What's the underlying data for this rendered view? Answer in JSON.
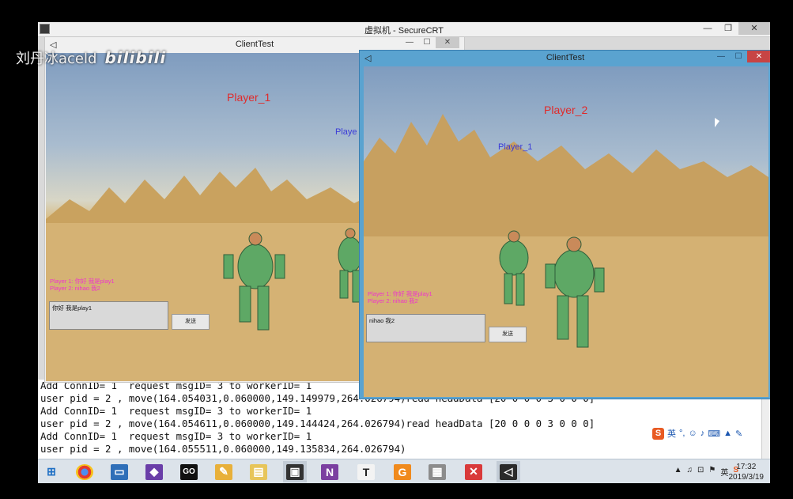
{
  "watermark": {
    "author": "刘丹冰aceld",
    "logo": "bilibili"
  },
  "securecrt": {
    "title": "虚拟机 - SecureCRT",
    "terminal_lines": [
      "Add ConnID= 1  request msgID= 3 to workerID= 1",
      "user pid = 2 , move(164.054031,0.060000,149.149979,264.026794)read headData [20 0 0 0 3 0 0 0]",
      "Add ConnID= 1  request msgID= 3 to workerID= 1",
      "user pid = 2 , move(164.054611,0.060000,149.144424,264.026794)read headData [20 0 0 0 3 0 0 0]",
      "Add ConnID= 1  request msgID= 3 to workerID= 1",
      "user pid = 2 , move(164.055511,0.060000,149.135834,264.026794)"
    ]
  },
  "window1": {
    "title": "ClientTest",
    "player_self": "Player_1",
    "player_other": "Playe",
    "chat": [
      "Player 1: 你好 我是play1",
      "Player 2: nihao 我2"
    ],
    "input_value": "你好 我是play1",
    "send_label": "发送"
  },
  "window2": {
    "title": "ClientTest",
    "player_self": "Player_2",
    "player_other": "Player_1",
    "chat": [
      "Player 1: 你好 我是play1",
      "Player 2: nihao 我2"
    ],
    "input_value": "nihao 我2",
    "send_label": "发送"
  },
  "ime": {
    "logo": "S",
    "lang": "英"
  },
  "taskbar": {
    "apps": [
      {
        "icon": "windows-start-icon",
        "label": ""
      },
      {
        "icon": "chrome-icon",
        "label": ""
      },
      {
        "icon": "remote-desktop-icon",
        "label": ""
      },
      {
        "icon": "visual-studio-icon",
        "label": ""
      },
      {
        "icon": "goland-icon",
        "label": "GO"
      },
      {
        "icon": "paint-icon",
        "label": ""
      },
      {
        "icon": "file-explorer-icon",
        "label": ""
      },
      {
        "icon": "securecrt-icon",
        "label": ""
      },
      {
        "icon": "onenote-icon",
        "label": "N"
      },
      {
        "icon": "typora-icon",
        "label": "T"
      },
      {
        "icon": "pdf-reader-icon",
        "label": ""
      },
      {
        "icon": "archive-icon",
        "label": ""
      },
      {
        "icon": "xmind-icon",
        "label": ""
      },
      {
        "icon": "unity-icon",
        "label": ""
      }
    ],
    "tray_lang": "英",
    "time": "17:32",
    "date": "2019/3/19"
  },
  "colors": {
    "player_red": "#e02a2a",
    "player_blue": "#3b3bd8",
    "chat_magenta": "#ee33cc",
    "win2_frame": "#5aa3d0"
  }
}
